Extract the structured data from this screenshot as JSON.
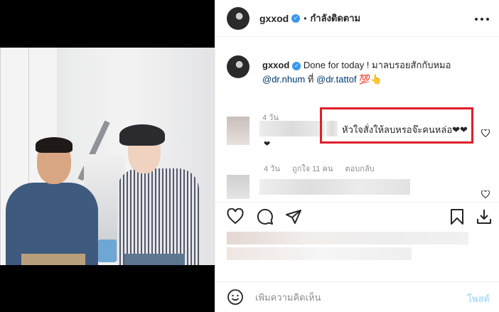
{
  "header": {
    "username": "gxxod",
    "separator": "•",
    "follow_status": "กำลังติดตาม",
    "more_icon": "more-horizontal-icon"
  },
  "caption": {
    "username": "gxxod",
    "text_main": "Done for today ! มาลบรอยสักกับหมอ",
    "mention1": "@dr.nhum",
    "joiner": "ที่",
    "mention2": "@dr.tattof",
    "emojis": "💯👆",
    "time": "4 วัน"
  },
  "highlighted_comment": {
    "text": "หัวใจสั่งให้ลบหรอจ๊ะคนหล่อ❤❤",
    "heart_wrap": "❤",
    "time": "4 วัน",
    "likes": "ถูกใจ 11 คน",
    "reply": "ตอบกลับ",
    "highlight_color": "#e01e2a"
  },
  "actions": {
    "like_icon": "heart-outline-icon",
    "comment_icon": "comment-bubble-icon",
    "share_icon": "paper-plane-icon",
    "save_icon": "bookmark-icon",
    "download_icon": "download-icon"
  },
  "add_comment": {
    "placeholder": "เพิ่มความคิดเห็น",
    "post_label": "โพสต์",
    "emoji_icon": "smiley-icon"
  },
  "colors": {
    "link": "#00376b",
    "verified": "#3897f0",
    "muted": "#8e8e8e",
    "post_button": "#b2dffc"
  }
}
